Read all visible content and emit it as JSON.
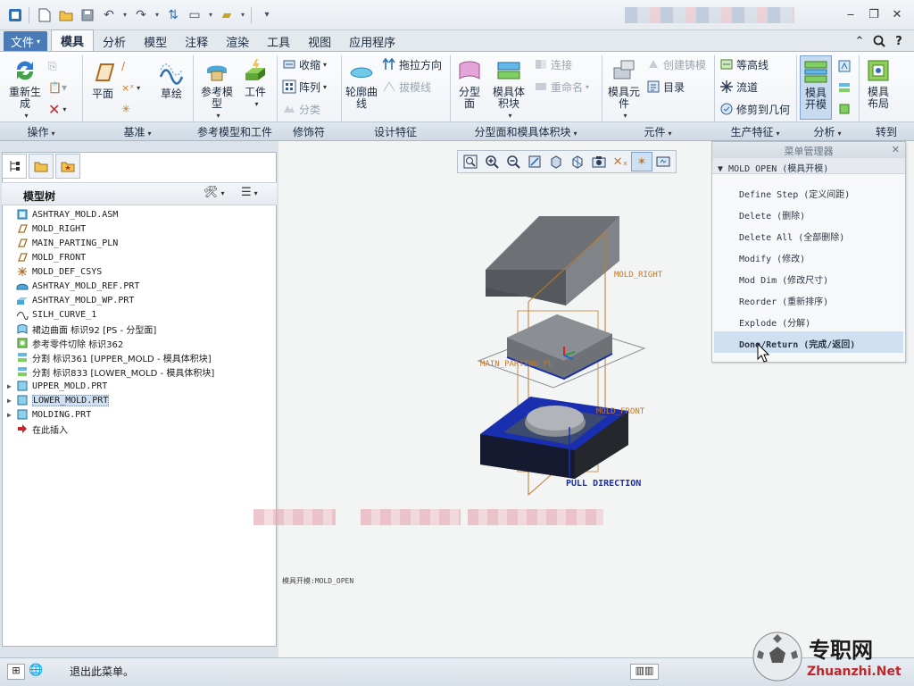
{
  "tabs": [
    "文件",
    "模具",
    "分析",
    "模型",
    "注释",
    "渲染",
    "工具",
    "视图",
    "应用程序"
  ],
  "ribbon": {
    "regenerate": "重新生成",
    "plane": "平面",
    "sketch": "草绘",
    "ref_model": "参考模型",
    "workpiece": "工件",
    "shrink": "收缩",
    "pattern": "阵列",
    "classify": "分类",
    "contour_curve": "轮廓曲线",
    "drag_direction": "拖拉方向",
    "draft_line": "拔模线",
    "parting_surface": "分型面",
    "mold_volume": "模具体积块",
    "connect": "连接",
    "rename": "重命名",
    "component": "模具元件",
    "create_casting": "创建铸模",
    "catalog": "目录",
    "contour_line": "等高线",
    "flow": "流道",
    "trim_geometry": "修剪到几何",
    "mold_open": "模具开模",
    "mold_layout": "模具布局"
  },
  "groups": [
    "操作",
    "基准",
    "参考模型和工件",
    "修饰符",
    "设计特征",
    "分型面和模具体积块",
    "元件",
    "生产特征",
    "分析",
    "转到"
  ],
  "model_tree": {
    "title": "模型树",
    "items": [
      {
        "label": "ASHTRAY_MOLD.ASM",
        "icon": "assembly",
        "level": 0,
        "expandable": false
      },
      {
        "label": "MOLD_RIGHT",
        "icon": "datum-plane",
        "level": 1,
        "expandable": false
      },
      {
        "label": "MAIN_PARTING_PLN",
        "icon": "datum-plane",
        "level": 1,
        "expandable": false
      },
      {
        "label": "MOLD_FRONT",
        "icon": "datum-plane",
        "level": 1,
        "expandable": false
      },
      {
        "label": "MOLD_DEF_CSYS",
        "icon": "csys",
        "level": 1,
        "expandable": false
      },
      {
        "label": "ASHTRAY_MOLD_REF.PRT",
        "icon": "part-ref",
        "level": 1,
        "expandable": false
      },
      {
        "label": "ASHTRAY_MOLD_WP.PRT",
        "icon": "part-wp",
        "level": 1,
        "expandable": false
      },
      {
        "label": "SILH_CURVE_1",
        "icon": "curve",
        "level": 1,
        "expandable": false
      },
      {
        "label": "裙边曲面 标识92 [PS - 分型面]",
        "icon": "surface",
        "level": 1,
        "expandable": false
      },
      {
        "label": "参考零件切除 标识362",
        "icon": "cut",
        "level": 1,
        "expandable": false
      },
      {
        "label": "分割 标识361 [UPPER_MOLD - 模具体积块]",
        "icon": "split",
        "level": 1,
        "expandable": false
      },
      {
        "label": "分割 标识833 [LOWER_MOLD - 模具体积块]",
        "icon": "split",
        "level": 1,
        "expandable": false
      },
      {
        "label": "UPPER_MOLD.PRT",
        "icon": "part",
        "level": 1,
        "expandable": true
      },
      {
        "label": "LOWER_MOLD.PRT",
        "icon": "part",
        "level": 1,
        "expandable": true,
        "selected": true
      },
      {
        "label": "MOLDING.PRT",
        "icon": "part",
        "level": 1,
        "expandable": true
      },
      {
        "label": "在此插入",
        "icon": "insert-arrow",
        "level": 1,
        "expandable": false
      }
    ]
  },
  "menu_manager": {
    "title": "菜单管理器",
    "header": "MOLD OPEN (模具开模)",
    "items": [
      "Define Step (定义间距)",
      "Delete (删除)",
      "Delete All (全部删除)",
      "Modify (修改)",
      "Mod Dim (修改尺寸)",
      "Reorder (重新排序)",
      "Explode (分解)",
      "Done/Return (完成/返回)"
    ],
    "highlighted_index": 7
  },
  "viewport": {
    "labels": {
      "mold_right": "MOLD_RIGHT",
      "main_parting": "MAIN_PARTING_PL",
      "mold_front": "MOLD_FRONT",
      "pull_direction": "PULL DIRECTION",
      "mode_text": "模具开模:MOLD_OPEN"
    }
  },
  "status": {
    "message": "退出此菜单。"
  },
  "watermark": {
    "brand": "专职网",
    "url": "Zhuanzhi.Net"
  },
  "colors": {
    "file_tab": "#4a7bb7",
    "mold_grey": "#6e7276",
    "mold_blue": "#1a2fb0",
    "datum_orange": "#c07a2a",
    "selection": "#cfe0f5"
  }
}
